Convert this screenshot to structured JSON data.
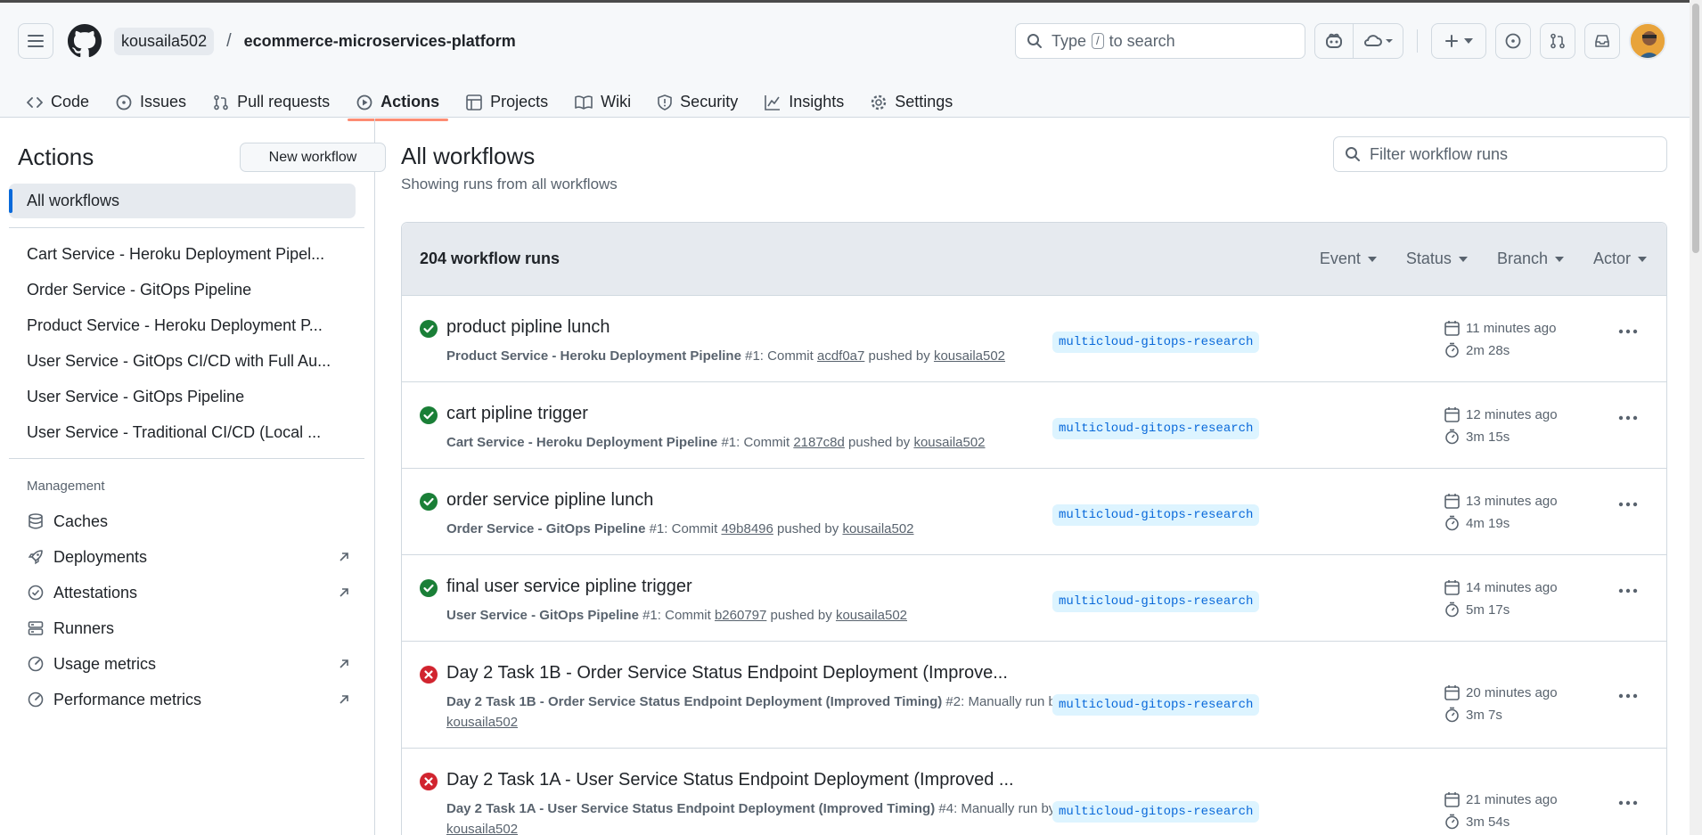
{
  "header": {
    "owner": "kousaila502",
    "separator": "/",
    "repo": "ecommerce-microservices-platform",
    "search_prefix": "Type",
    "search_key": "/",
    "search_suffix": "to search"
  },
  "tabs": [
    {
      "label": "Code",
      "icon": "code-icon"
    },
    {
      "label": "Issues",
      "icon": "issue-icon"
    },
    {
      "label": "Pull requests",
      "icon": "pull-request-icon"
    },
    {
      "label": "Actions",
      "icon": "play-icon",
      "active": true
    },
    {
      "label": "Projects",
      "icon": "table-icon"
    },
    {
      "label": "Wiki",
      "icon": "book-icon"
    },
    {
      "label": "Security",
      "icon": "shield-icon"
    },
    {
      "label": "Insights",
      "icon": "graph-icon"
    },
    {
      "label": "Settings",
      "icon": "gear-icon"
    }
  ],
  "sidebar": {
    "title": "Actions",
    "new_workflow": "New workflow",
    "all_workflows": "All workflows",
    "workflows": [
      "Cart Service - Heroku Deployment Pipel...",
      "Order Service - GitOps Pipeline",
      "Product Service - Heroku Deployment P...",
      "User Service - GitOps CI/CD with Full Au...",
      "User Service - GitOps Pipeline",
      "User Service - Traditional CI/CD (Local ..."
    ],
    "management_label": "Management",
    "management": [
      {
        "label": "Caches",
        "icon": "database-icon",
        "external": false
      },
      {
        "label": "Deployments",
        "icon": "rocket-icon",
        "external": true
      },
      {
        "label": "Attestations",
        "icon": "verified-icon",
        "external": true
      },
      {
        "label": "Runners",
        "icon": "server-icon",
        "external": false
      },
      {
        "label": "Usage metrics",
        "icon": "meter-icon",
        "external": true
      },
      {
        "label": "Performance metrics",
        "icon": "meter-icon",
        "external": true
      }
    ]
  },
  "main": {
    "title": "All workflows",
    "subtitle": "Showing runs from all workflows",
    "filter_placeholder": "Filter workflow runs",
    "runs_count": "204 workflow runs",
    "filters": [
      "Event",
      "Status",
      "Branch",
      "Actor"
    ],
    "runs": [
      {
        "status": "success",
        "title": "product pipline lunch",
        "workflow": "Product Service - Heroku Deployment Pipeline",
        "number": "#1",
        "trigger": "Commit",
        "commit": "acdf0a7",
        "by": "pushed by",
        "actor": "kousaila502",
        "branch": "multicloud-gitops-research",
        "ago": "11 minutes ago",
        "duration": "2m 28s"
      },
      {
        "status": "success",
        "title": "cart pipline trigger",
        "workflow": "Cart Service - Heroku Deployment Pipeline",
        "number": "#1",
        "trigger": "Commit",
        "commit": "2187c8d",
        "by": "pushed by",
        "actor": "kousaila502",
        "branch": "multicloud-gitops-research",
        "ago": "12 minutes ago",
        "duration": "3m 15s"
      },
      {
        "status": "success",
        "title": "order service pipline lunch",
        "workflow": "Order Service - GitOps Pipeline",
        "number": "#1",
        "trigger": "Commit",
        "commit": "49b8496",
        "by": "pushed by",
        "actor": "kousaila502",
        "branch": "multicloud-gitops-research",
        "ago": "13 minutes ago",
        "duration": "4m 19s"
      },
      {
        "status": "success",
        "title": "final user service pipline trigger",
        "workflow": "User Service - GitOps Pipeline",
        "number": "#1",
        "trigger": "Commit",
        "commit": "b260797",
        "by": "pushed by",
        "actor": "kousaila502",
        "branch": "multicloud-gitops-research",
        "ago": "14 minutes ago",
        "duration": "5m 17s"
      },
      {
        "status": "failure",
        "title": "Day 2 Task 1B - Order Service Status Endpoint Deployment (Improve...",
        "workflow": "Day 2 Task 1B - Order Service Status Endpoint Deployment (Improved Timing)",
        "number": "#2",
        "trigger": "Manually run",
        "commit": "",
        "by": "by",
        "actor": "kousaila502",
        "branch": "multicloud-gitops-research",
        "ago": "20 minutes ago",
        "duration": "3m 7s"
      },
      {
        "status": "failure",
        "title": "Day 2 Task 1A - User Service Status Endpoint Deployment (Improved ...",
        "workflow": "Day 2 Task 1A - User Service Status Endpoint Deployment (Improved Timing)",
        "number": "#4",
        "trigger": "Manually run",
        "commit": "",
        "by": "by",
        "actor": "kousaila502",
        "branch": "multicloud-gitops-research",
        "ago": "21 minutes ago",
        "duration": "3m 54s"
      }
    ]
  },
  "colors": {
    "success": "#1a7f37",
    "failure": "#d1242f",
    "accent": "#0969da",
    "tab_underline": "#fd8c73"
  }
}
